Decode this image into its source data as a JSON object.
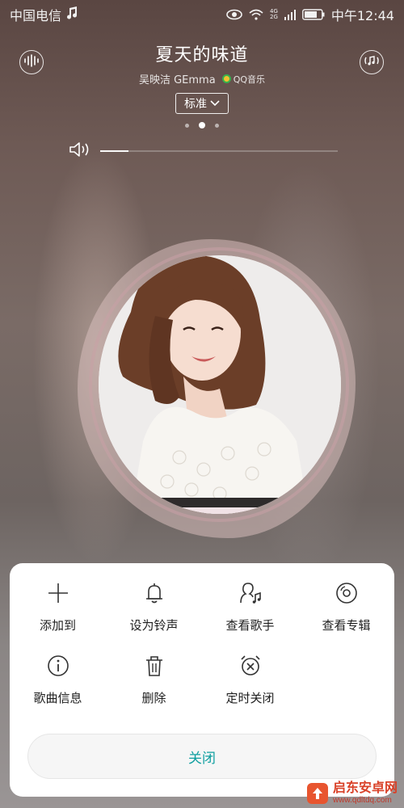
{
  "status_bar": {
    "carrier": "中国电信",
    "time": "中午12:44",
    "network_top": "4G",
    "network_bottom": "2G"
  },
  "player": {
    "title": "夏天的味道",
    "artist": "吴映洁 GEmma",
    "source": "QQ音乐",
    "quality": "标准",
    "page_index": 2,
    "page_count": 3,
    "volume_level": 0.12
  },
  "menu": {
    "row1": [
      {
        "label": "添加到",
        "icon": "plus-icon"
      },
      {
        "label": "设为铃声",
        "icon": "bell-icon"
      },
      {
        "label": "查看歌手",
        "icon": "singer-icon"
      },
      {
        "label": "查看专辑",
        "icon": "disc-icon"
      }
    ],
    "row2": [
      {
        "label": "歌曲信息",
        "icon": "info-icon"
      },
      {
        "label": "删除",
        "icon": "trash-icon"
      },
      {
        "label": "定时关闭",
        "icon": "alarm-off-icon"
      }
    ],
    "close_label": "关闭"
  },
  "watermark": {
    "name": "启东安卓网",
    "url": "www.qdltdq.com"
  },
  "colors": {
    "accent": "#0f9fa0",
    "sheet_bg": "#ffffff"
  }
}
